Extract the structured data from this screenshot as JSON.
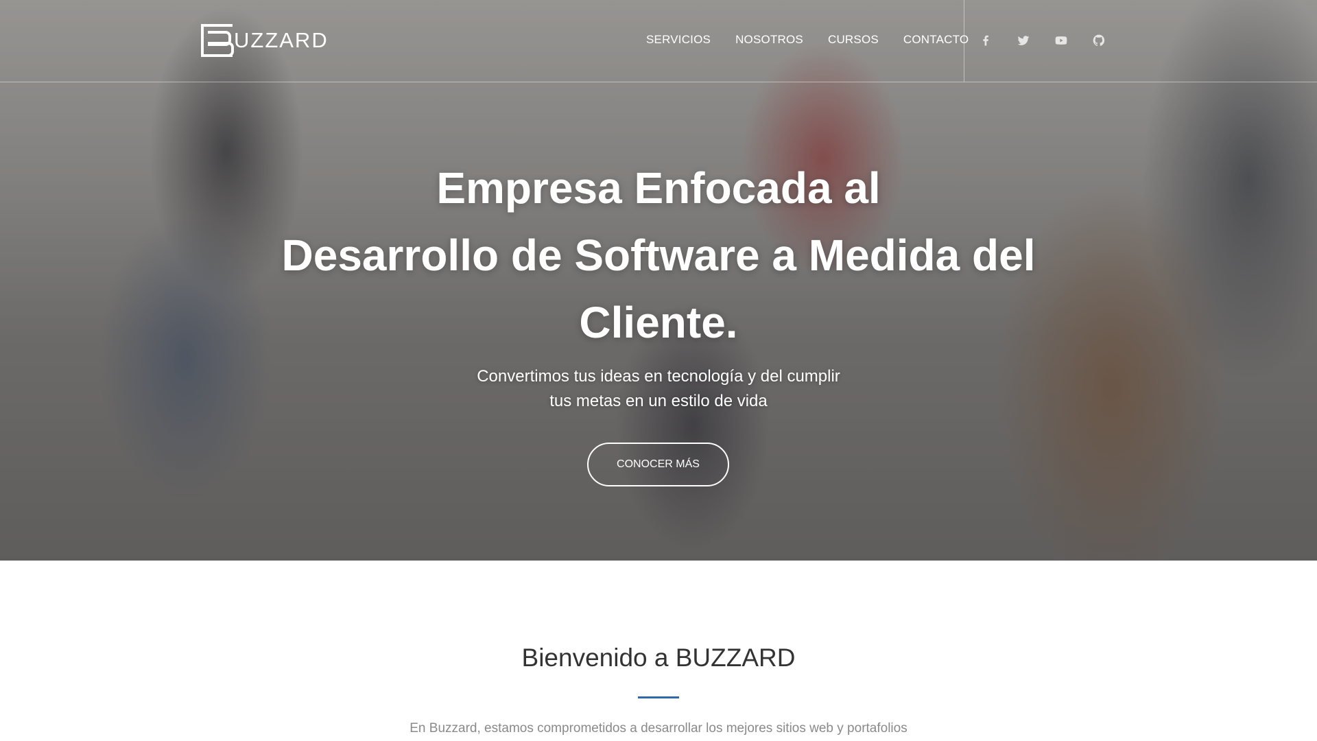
{
  "brand": {
    "logo_text": "UZZARD",
    "logo_full": "BUZZARD"
  },
  "nav": {
    "items": [
      {
        "label": "SERVICIOS"
      },
      {
        "label": "NOSOTROS"
      },
      {
        "label": "CURSOS"
      },
      {
        "label": "CONTACTO"
      }
    ]
  },
  "social": {
    "icons": [
      "facebook-icon",
      "twitter-icon",
      "youtube-icon",
      "github-icon"
    ]
  },
  "hero": {
    "title_line1": "Empresa Enfocada al",
    "title_line2": "Desarrollo de Software a Medida del",
    "title_line3": "Cliente.",
    "subtitle_line1": "Convertimos tus ideas en tecnología y del cumplir",
    "subtitle_line2": "tus metas en un estilo de vida",
    "cta_label": "CONOCER MÁS"
  },
  "welcome": {
    "title": "Bienvenido a BUZZARD",
    "text": "En Buzzard, estamos comprometidos a desarrollar los mejores sitios web y portafolios"
  },
  "colors": {
    "accent": "#2d6aa6",
    "text_dark": "#333333",
    "text_muted": "#8a8a8a"
  }
}
